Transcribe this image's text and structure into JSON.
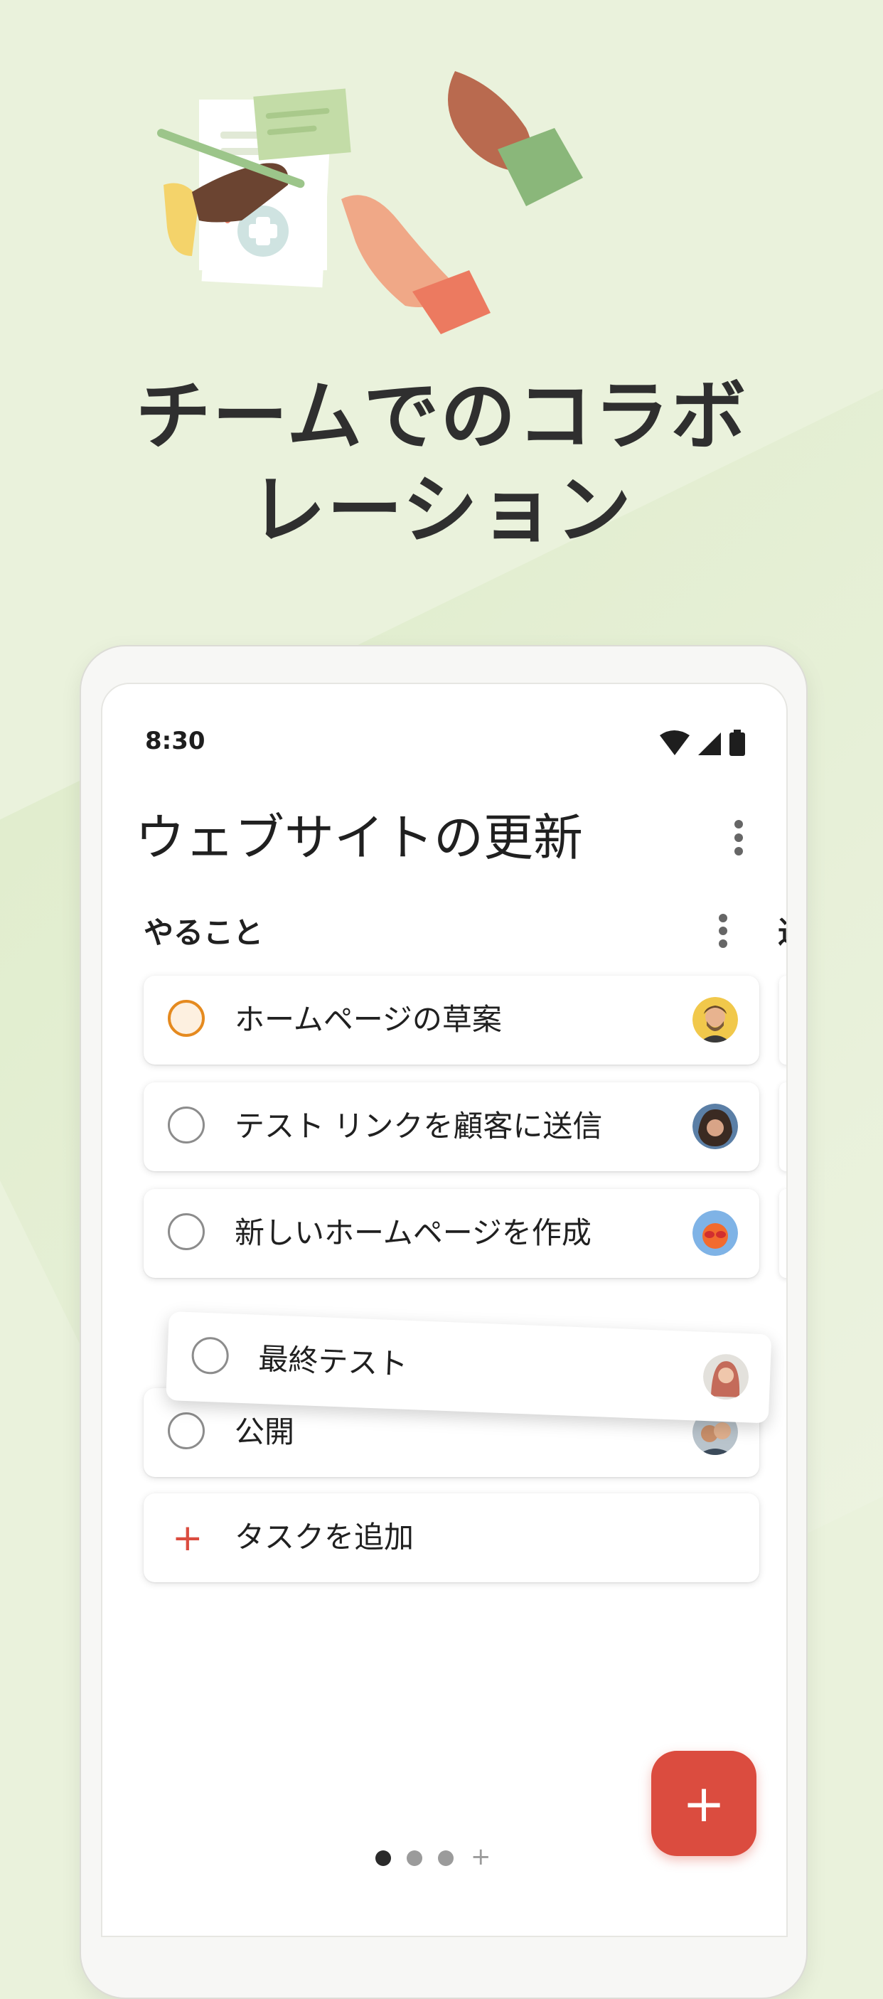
{
  "headline": {
    "line1": "チームでのコラボ",
    "line2": "レーション"
  },
  "status_bar": {
    "time": "8:30"
  },
  "project": {
    "title": "ウェブサイトの更新"
  },
  "section": {
    "title": "やること",
    "next_peek": "进"
  },
  "tasks": [
    {
      "label": "ホームページの草案",
      "priority": true
    },
    {
      "label": "テスト リンクを顧客に送信",
      "priority": false
    },
    {
      "label": "新しいホームページを作成",
      "priority": false
    },
    {
      "label": "最終テスト",
      "priority": false,
      "dragging": true
    },
    {
      "label": "公開",
      "priority": false
    }
  ],
  "add_task": {
    "icon": "+",
    "label": "タスクを追加"
  },
  "fab": {
    "icon": "+"
  },
  "pager": {
    "pages": 3,
    "active_index": 0,
    "add_icon": "+"
  },
  "colors": {
    "accent": "#db4c3f",
    "priority": "#e58a1f",
    "background": "#eaf2dc"
  }
}
